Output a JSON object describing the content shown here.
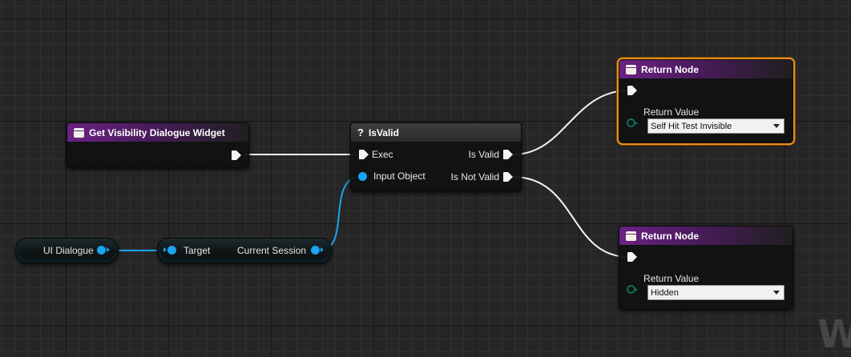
{
  "nodes": {
    "get_visibility": {
      "title": "Get Visibility Dialogue Widget"
    },
    "is_valid": {
      "title": "IsValid",
      "exec_label": "Exec",
      "input_object_label": "Input Object",
      "is_valid_label": "Is Valid",
      "is_not_valid_label": "Is Not Valid"
    },
    "return_top": {
      "title": "Return Node",
      "return_value_label": "Return Value",
      "return_value": "Self Hit Test Invisible"
    },
    "return_bottom": {
      "title": "Return Node",
      "return_value_label": "Return Value",
      "return_value": "Hidden"
    },
    "ui_dialogue": {
      "label": "UI Dialogue"
    },
    "current_session": {
      "target_label": "Target",
      "output_label": "Current Session"
    }
  },
  "colors": {
    "exec_wire": "#f4f4f4",
    "object_wire": "#1aa3f0",
    "function_header": "#6a2282",
    "selection": "#e7901a",
    "enum_pin": "#0f6e58"
  },
  "watermark": "W"
}
